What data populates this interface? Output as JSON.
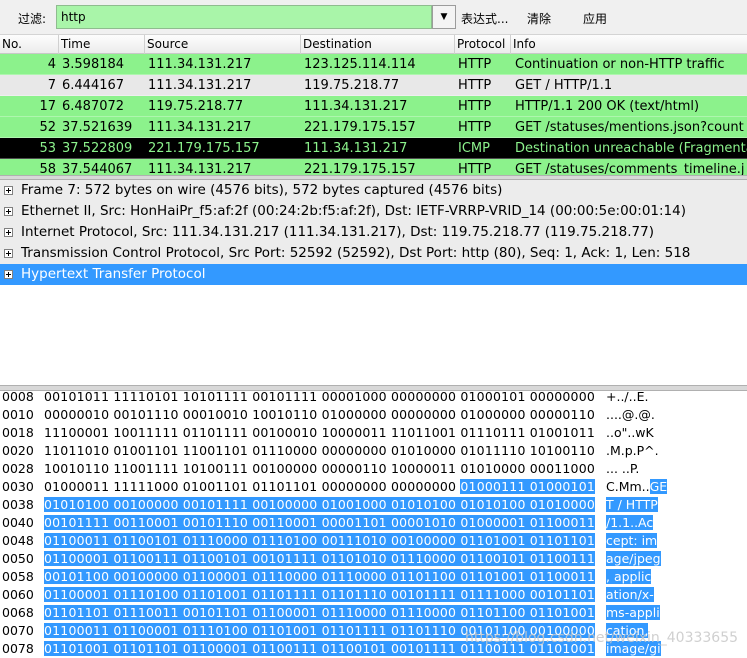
{
  "filter": {
    "label": "过滤:",
    "value": "http",
    "expression_btn": "表达式...",
    "clear_btn": "清除",
    "apply_btn": "应用"
  },
  "columns": [
    "No.",
    "Time",
    "Source",
    "Destination",
    "Protocol",
    "Info"
  ],
  "packets": [
    {
      "no": "4",
      "time": "3.598184",
      "src": "111.34.131.217",
      "dst": "123.125.114.114",
      "proto": "HTTP",
      "info": "Continuation or non-HTTP traffic",
      "bg": "#8cf28c",
      "fg": "#000000"
    },
    {
      "no": "7",
      "time": "6.444167",
      "src": "111.34.131.217",
      "dst": "119.75.218.77",
      "proto": "HTTP",
      "info": "GET / HTTP/1.1",
      "bg": "#e8e8e8",
      "fg": "#000000"
    },
    {
      "no": "17",
      "time": "6.487072",
      "src": "119.75.218.77",
      "dst": "111.34.131.217",
      "proto": "HTTP",
      "info": "HTTP/1.1 200 OK  (text/html)",
      "bg": "#8cf28c",
      "fg": "#000000"
    },
    {
      "no": "52",
      "time": "37.521639",
      "src": "111.34.131.217",
      "dst": "221.179.175.157",
      "proto": "HTTP",
      "info": "GET /statuses/mentions.json?count",
      "bg": "#8cf28c",
      "fg": "#000000"
    },
    {
      "no": "53",
      "time": "37.522809",
      "src": "221.179.175.157",
      "dst": "111.34.131.217",
      "proto": "ICMP",
      "info": "Destination unreachable (Fragmentat",
      "bg": "#000000",
      "fg": "#8cf28c"
    },
    {
      "no": "58",
      "time": "37.544067",
      "src": "111.34.131.217",
      "dst": "221.179.175.157",
      "proto": "HTTP",
      "info": "GET /statuses/comments_timeline.j",
      "bg": "#8cf28c",
      "fg": "#000000"
    }
  ],
  "details": [
    {
      "text": "Frame 7: 572 bytes on wire (4576 bits), 572 bytes captured (4576 bits)",
      "selected": false
    },
    {
      "text": "Ethernet II, Src: HonHaiPr_f5:af:2f (00:24:2b:f5:af:2f), Dst: IETF-VRRP-VRID_14 (00:00:5e:00:01:14)",
      "selected": false
    },
    {
      "text": "Internet Protocol, Src: 111.34.131.217 (111.34.131.217), Dst: 119.75.218.77 (119.75.218.77)",
      "selected": false
    },
    {
      "text": "Transmission Control Protocol, Src Port: 52592 (52592), Dst Port: http (80), Seq: 1, Ack: 1, Len: 518",
      "selected": false
    },
    {
      "text": "Hypertext Transfer Protocol",
      "selected": true
    }
  ],
  "bytes": [
    {
      "offset": "0008",
      "bits": "00101011 11110101 10101111 00101111 00001000 00000000 01000101 00000000",
      "ascii": "+../..E.",
      "hl_from": -1,
      "ascii_hl_from": -1
    },
    {
      "offset": "0010",
      "bits": "00000010 00101110 00010010 10010110 01000000 00000000 01000000 00000110",
      "ascii": "....@.@.",
      "hl_from": -1,
      "ascii_hl_from": -1
    },
    {
      "offset": "0018",
      "bits": "11100001 10011111 01101111 00100010 10000011 11011001 01110111 01001011",
      "ascii": "..o\"..wK",
      "hl_from": -1,
      "ascii_hl_from": -1
    },
    {
      "offset": "0020",
      "bits": "11011010 01001101 11001101 01110000 00000000 01010000 01011110 10100110",
      "ascii": ".M.p.P^.",
      "hl_from": -1,
      "ascii_hl_from": -1
    },
    {
      "offset": "0028",
      "bits": "10010110 11001111 10100111 00100000 00000110 10000011 01010000 00011000",
      "ascii": "... ..P.",
      "hl_from": -1,
      "ascii_hl_from": -1
    },
    {
      "offset": "0030",
      "bits": "01000011 11111000 01001101 01101101 00000000 00000000 01000111 01000101",
      "ascii": "C.Mm..GE",
      "hl_from": 6,
      "ascii_hl_from": 6
    },
    {
      "offset": "0038",
      "bits": "01010100 00100000 00101111 00100000 01001000 01010100 01010100 01010000",
      "ascii": "T / HTTP",
      "hl_from": 0,
      "ascii_hl_from": 0
    },
    {
      "offset": "0040",
      "bits": "00101111 00110001 00101110 00110001 00001101 00001010 01000001 01100011",
      "ascii": "/1.1..Ac",
      "hl_from": 0,
      "ascii_hl_from": 0
    },
    {
      "offset": "0048",
      "bits": "01100011 01100101 01110000 01110100 00111010 00100000 01101001 01101101",
      "ascii": "cept: im",
      "hl_from": 0,
      "ascii_hl_from": 0
    },
    {
      "offset": "0050",
      "bits": "01100001 01100111 01100101 00101111 01101010 01110000 01100101 01100111",
      "ascii": "age/jpeg",
      "hl_from": 0,
      "ascii_hl_from": 0
    },
    {
      "offset": "0058",
      "bits": "00101100 00100000 01100001 01110000 01110000 01101100 01101001 01100011",
      "ascii": ", applic",
      "hl_from": 0,
      "ascii_hl_from": 0
    },
    {
      "offset": "0060",
      "bits": "01100001 01110100 01101001 01101111 01101110 00101111 01111000 00101101",
      "ascii": "ation/x-",
      "hl_from": 0,
      "ascii_hl_from": 0
    },
    {
      "offset": "0068",
      "bits": "01101101 01110011 00101101 01100001 01110000 01110000 01101100 01101001",
      "ascii": "ms-appli",
      "hl_from": 0,
      "ascii_hl_from": 0
    },
    {
      "offset": "0070",
      "bits": "01100011 01100001 01110100 01101001 01101111 01101110 00101100 00100000",
      "ascii": "cation, ",
      "hl_from": 0,
      "ascii_hl_from": 0
    },
    {
      "offset": "0078",
      "bits": "01101001 01101101 01100001 01100111 01100101 00101111 01100111 01101001",
      "ascii": "image/gi",
      "hl_from": 0,
      "ascii_hl_from": 0
    }
  ],
  "watermark": "https://blog.csdn.net/weixin_40333655",
  "colors": {
    "selected": "#3399ff",
    "http_row": "#8cf28c",
    "filter_ok": "#a9f5a9"
  }
}
